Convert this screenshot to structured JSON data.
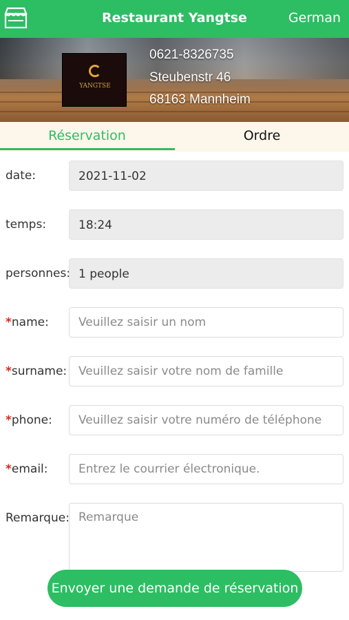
{
  "header": {
    "title": "Restaurant Yangtse",
    "language": "German",
    "shop_icon": "storefront-icon"
  },
  "restaurant": {
    "logo_text": "YANGTSE",
    "phone": "0621-8326735",
    "street": "Steubenstr 46",
    "city": "68163 Mannheim"
  },
  "tabs": [
    {
      "label": "Réservation",
      "active": true
    },
    {
      "label": "Ordre",
      "active": false
    }
  ],
  "form": {
    "date": {
      "label": "date:",
      "value": "2021-11-02"
    },
    "time": {
      "label": "temps:",
      "value": "18:24"
    },
    "persons": {
      "label": "personnes:",
      "value": "1 people"
    },
    "name": {
      "required_mark": "*",
      "label": "name:",
      "placeholder": "Veuillez saisir un nom"
    },
    "surname": {
      "required_mark": "*",
      "label": "surname:",
      "placeholder": "Veuillez saisir votre nom de famille"
    },
    "phone": {
      "required_mark": "*",
      "label": "phone:",
      "placeholder": "Veuillez saisir votre numéro de téléphone"
    },
    "email": {
      "required_mark": "*",
      "label": "email:",
      "placeholder": "Entrez le courrier électronique."
    },
    "remark": {
      "label": "Remarque:",
      "placeholder": "Remarque"
    }
  },
  "submit_label": "Envoyer une demande de réservation",
  "colors": {
    "accent": "#2dbd63",
    "required": "#d9261c",
    "tab_bg": "#fdf6ea"
  }
}
